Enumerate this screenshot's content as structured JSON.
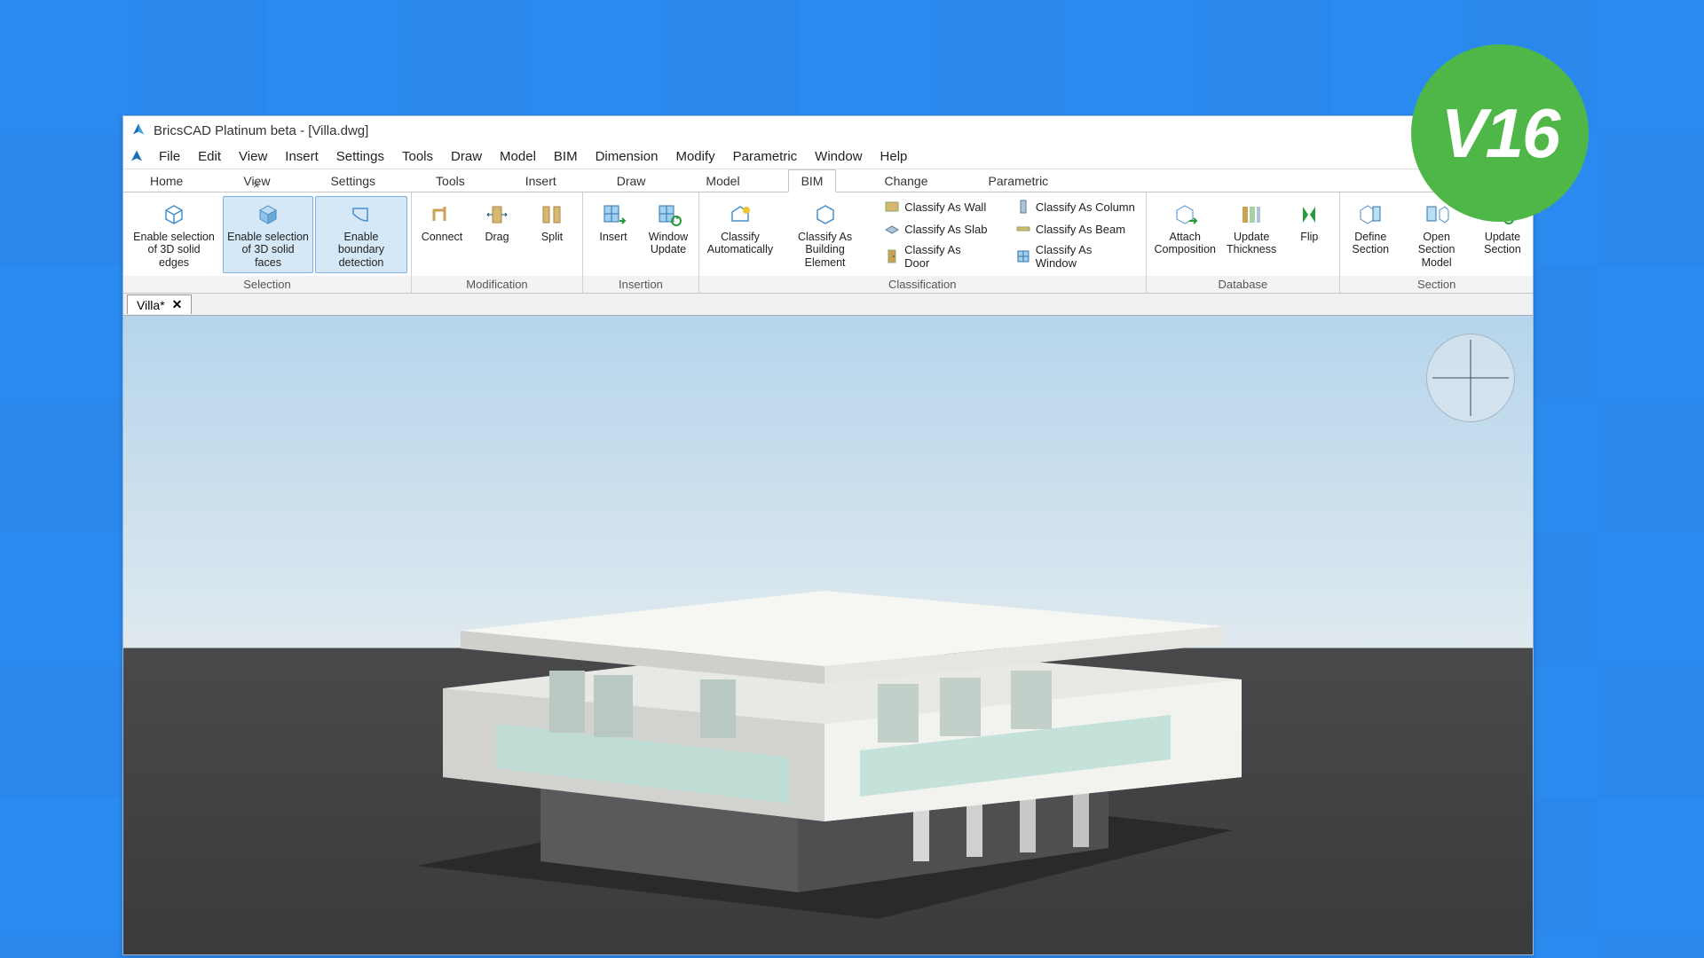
{
  "version_badge": "V16",
  "title": "BricsCAD Platinum beta - [Villa.dwg]",
  "menu": [
    "File",
    "Edit",
    "View",
    "Insert",
    "Settings",
    "Tools",
    "Draw",
    "Model",
    "BIM",
    "Dimension",
    "Modify",
    "Parametric",
    "Window",
    "Help"
  ],
  "ribbon_tabs": [
    "Home",
    "View",
    "Settings",
    "Tools",
    "Insert",
    "Draw",
    "Model",
    "BIM",
    "Change",
    "Parametric"
  ],
  "ribbon_active_tab": "BIM",
  "groups": {
    "selection": {
      "label": "Selection",
      "buttons": [
        {
          "id": "sel-edges",
          "label": "Enable selection\nof 3D solid edges"
        },
        {
          "id": "sel-faces",
          "label": "Enable selection\nof 3D solid faces"
        },
        {
          "id": "sel-boundary",
          "label": "Enable boundary\ndetection"
        }
      ]
    },
    "modification": {
      "label": "Modification",
      "buttons": [
        {
          "id": "connect",
          "label": "Connect"
        },
        {
          "id": "drag",
          "label": "Drag"
        },
        {
          "id": "split",
          "label": "Split"
        }
      ]
    },
    "insertion": {
      "label": "Insertion",
      "buttons": [
        {
          "id": "insert",
          "label": "Insert"
        },
        {
          "id": "win-update",
          "label": "Window\nUpdate"
        }
      ]
    },
    "classification": {
      "label": "Classification",
      "big": [
        {
          "id": "classify-auto",
          "label": "Classify\nAutomatically"
        },
        {
          "id": "classify-elem",
          "label": "Classify As\nBuilding Element"
        }
      ],
      "col1": [
        {
          "id": "classify-wall",
          "label": "Classify As Wall"
        },
        {
          "id": "classify-slab",
          "label": "Classify As Slab"
        },
        {
          "id": "classify-door",
          "label": "Classify As Door"
        }
      ],
      "col2": [
        {
          "id": "classify-column",
          "label": "Classify As Column"
        },
        {
          "id": "classify-beam",
          "label": "Classify As Beam"
        },
        {
          "id": "classify-window",
          "label": "Classify As Window"
        }
      ]
    },
    "database": {
      "label": "Database",
      "buttons": [
        {
          "id": "attach-comp",
          "label": "Attach\nComposition"
        },
        {
          "id": "update-thick",
          "label": "Update\nThickness"
        },
        {
          "id": "flip",
          "label": "Flip"
        }
      ]
    },
    "section": {
      "label": "Section",
      "buttons": [
        {
          "id": "define-section",
          "label": "Define\nSection"
        },
        {
          "id": "open-section",
          "label": "Open Section\nModel"
        },
        {
          "id": "update-section",
          "label": "Update\nSection"
        }
      ]
    }
  },
  "doc_tab": {
    "name": "Villa*"
  }
}
